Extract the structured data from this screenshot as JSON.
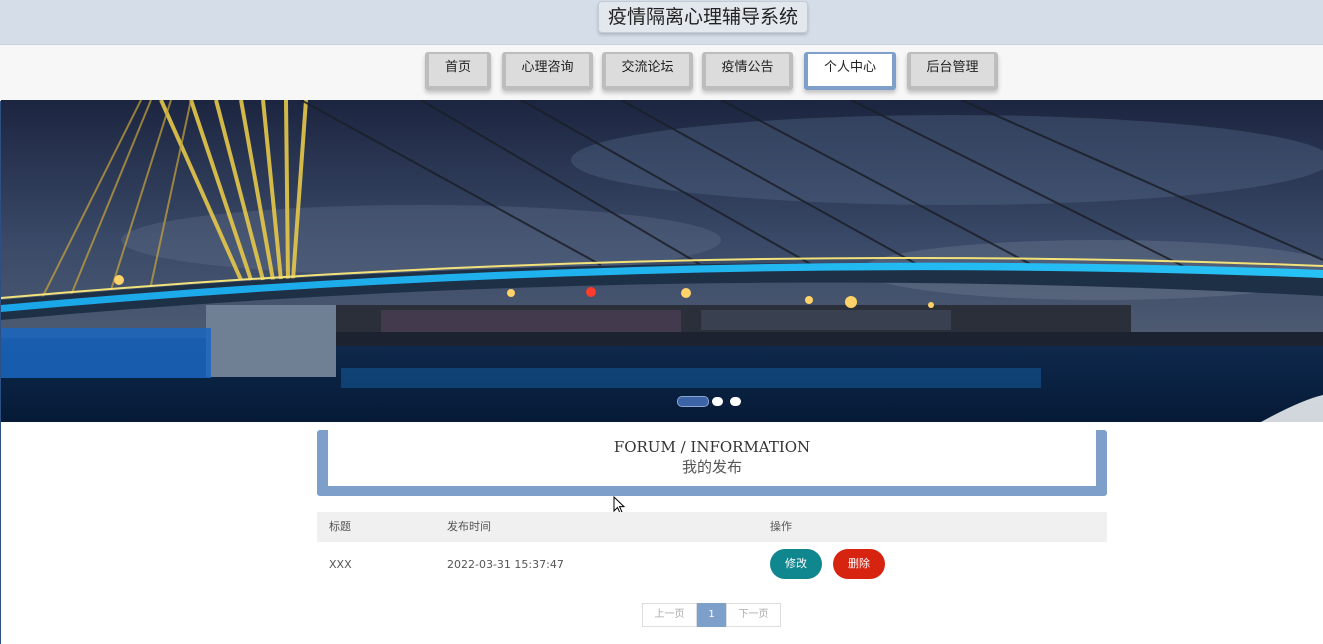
{
  "header": {
    "title": "疫情隔离心理辅导系统"
  },
  "nav": {
    "items": [
      {
        "label": "首页"
      },
      {
        "label": "心理咨询"
      },
      {
        "label": "交流论坛"
      },
      {
        "label": "疫情公告"
      },
      {
        "label": "个人中心",
        "active": true
      },
      {
        "label": "后台管理"
      }
    ]
  },
  "banner": {
    "slide_count": 3,
    "active_slide": 1
  },
  "section": {
    "title_en": "FORUM / INFORMATION",
    "title_cn": "我的发布"
  },
  "table": {
    "headers": [
      "标题",
      "发布时间",
      "操作"
    ],
    "rows": [
      {
        "title": "XXX",
        "time": "2022-03-31 15:37:47",
        "edit": "修改",
        "delete": "删除"
      }
    ]
  },
  "pagination": {
    "prev": "上一页",
    "current": "1",
    "next": "下一页"
  },
  "colors": {
    "accent": "#7f9fcb",
    "edit": "#10868f",
    "delete": "#d72410"
  }
}
